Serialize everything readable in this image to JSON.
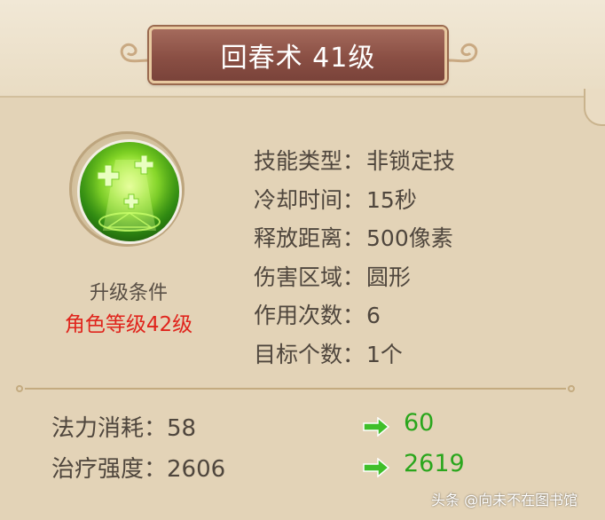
{
  "title": "回春术 41级",
  "skill_icon": "green-heal-cross-icon",
  "upgrade": {
    "label": "升级条件",
    "requirement": "角色等级42级",
    "requirement_color": "#e0241c"
  },
  "stats": [
    {
      "label": "技能类型：",
      "value": "非锁定技"
    },
    {
      "label": "冷却时间：",
      "value": "15秒"
    },
    {
      "label": "释放距离：",
      "value": "500像素"
    },
    {
      "label": "伤害区域：",
      "value": "圆形"
    },
    {
      "label": "作用次数：",
      "value": "6"
    },
    {
      "label": "目标个数：",
      "value": "1个"
    }
  ],
  "upgrade_stats": [
    {
      "label": "法力消耗：",
      "current": "58",
      "next": "60"
    },
    {
      "label": "治疗强度：",
      "current": "2606",
      "next": "2619"
    }
  ],
  "colors": {
    "title_plaque": "#8a4f44",
    "next_value": "#2aa61c",
    "arrow": "#3fbf2a"
  },
  "watermark": "头条 @向未不在图书馆"
}
